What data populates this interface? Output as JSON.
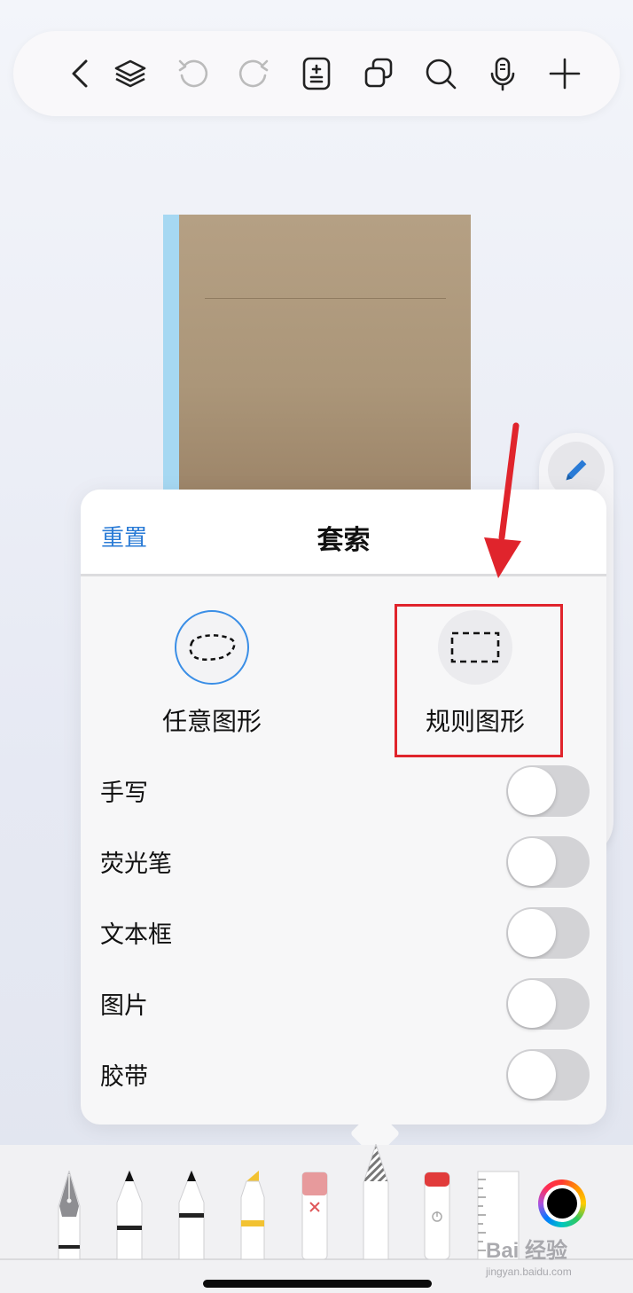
{
  "toolbar": {
    "icons": [
      "back-icon",
      "layers-icon",
      "undo-icon",
      "redo-icon",
      "page-add-icon",
      "duplicate-icon",
      "search-icon",
      "microphone-icon",
      "plus-icon"
    ]
  },
  "lasso_panel": {
    "title": "套索",
    "reset_label": "重置",
    "modes": [
      {
        "label": "任意图形",
        "icon": "freeform-lasso-icon",
        "selected": true
      },
      {
        "label": "规则图形",
        "icon": "rectangle-lasso-icon",
        "selected": false,
        "highlighted": true
      }
    ],
    "filters": [
      {
        "label": "手写",
        "on": false
      },
      {
        "label": "荧光笔",
        "on": false
      },
      {
        "label": "文本框",
        "on": false
      },
      {
        "label": "图片",
        "on": false
      },
      {
        "label": "胶带",
        "on": false
      }
    ]
  },
  "annotation": {
    "arrow_color": "#e0242c",
    "highlight_color": "#e0242c"
  },
  "tool_tray": {
    "tools": [
      "fountain-pen-icon",
      "ballpoint-pen-icon",
      "pencil-icon",
      "highlighter-icon",
      "eraser-icon",
      "lasso-tool-icon",
      "tape-icon",
      "ruler-icon"
    ],
    "current_color": "#000000"
  },
  "watermark": {
    "main": "Bai 经验",
    "sub": "jingyan.baidu.com"
  },
  "colors": {
    "accent": "#2a7bd6",
    "notebook_cover": "#b09c80",
    "notebook_spine": "#a6d8f2"
  }
}
